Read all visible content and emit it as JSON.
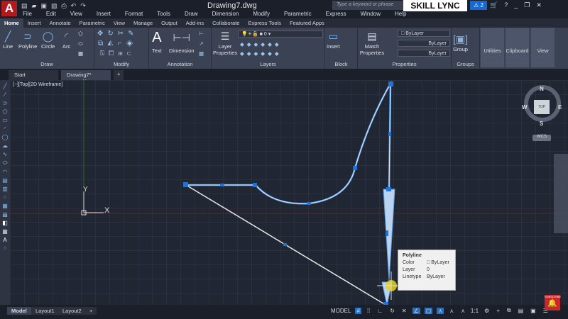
{
  "app": {
    "logo": "A",
    "title": "Drawing7.dwg",
    "search_placeholder": "Type a keyword or phrase",
    "brand": "SKILL LYNC",
    "alert_count": "2"
  },
  "menu": [
    "File",
    "Edit",
    "View",
    "Insert",
    "Format",
    "Tools",
    "Draw",
    "Dimension",
    "Modify",
    "Parametric",
    "Express",
    "Window",
    "Help"
  ],
  "ribbon_tabs": [
    "Home",
    "Insert",
    "Annotate",
    "Parametric",
    "View",
    "Manage",
    "Output",
    "Add-ins",
    "Collaborate",
    "Express Tools",
    "Featured Apps"
  ],
  "ribbon": {
    "draw": {
      "title": "Draw",
      "line": "Line",
      "polyline": "Polyline",
      "circle": "Circle",
      "arc": "Arc"
    },
    "modify": {
      "title": "Modify"
    },
    "annotation": {
      "title": "Annotation",
      "text": "Text",
      "dimension": "Dimension"
    },
    "layers": {
      "title": "Layers",
      "layer_properties": "Layer Properties",
      "current_layer": "0"
    },
    "block": {
      "title": "Block",
      "insert": "Insert"
    },
    "properties": {
      "title": "Properties",
      "match": "Match Properties",
      "color": "ByLayer",
      "lineweight": "ByLayer",
      "linetype": "ByLayer"
    },
    "groups": {
      "title": "Groups",
      "group": "Group"
    },
    "utilities": "Utilities",
    "clipboard": "Clipboard",
    "view": "View"
  },
  "doc_tabs": [
    "Start",
    "Drawing7*"
  ],
  "viewport_label": "[−][Top][2D Wireframe]",
  "ucs": {
    "x": "X",
    "y": "Y"
  },
  "viewcube": {
    "n": "N",
    "s": "S",
    "e": "E",
    "w": "W",
    "face": "TOP",
    "wcs": "WCS"
  },
  "tooltip": {
    "title": "Polyline",
    "rows": [
      {
        "k": "Color",
        "v": "ByLayer"
      },
      {
        "k": "Layer",
        "v": "0"
      },
      {
        "k": "Linetype",
        "v": "ByLayer"
      }
    ]
  },
  "layout_tabs": [
    "Model",
    "Layout1",
    "Layout2"
  ],
  "status": {
    "model": "MODEL",
    "scale": "1:1"
  },
  "subscribe": "SUBSCRIBE"
}
